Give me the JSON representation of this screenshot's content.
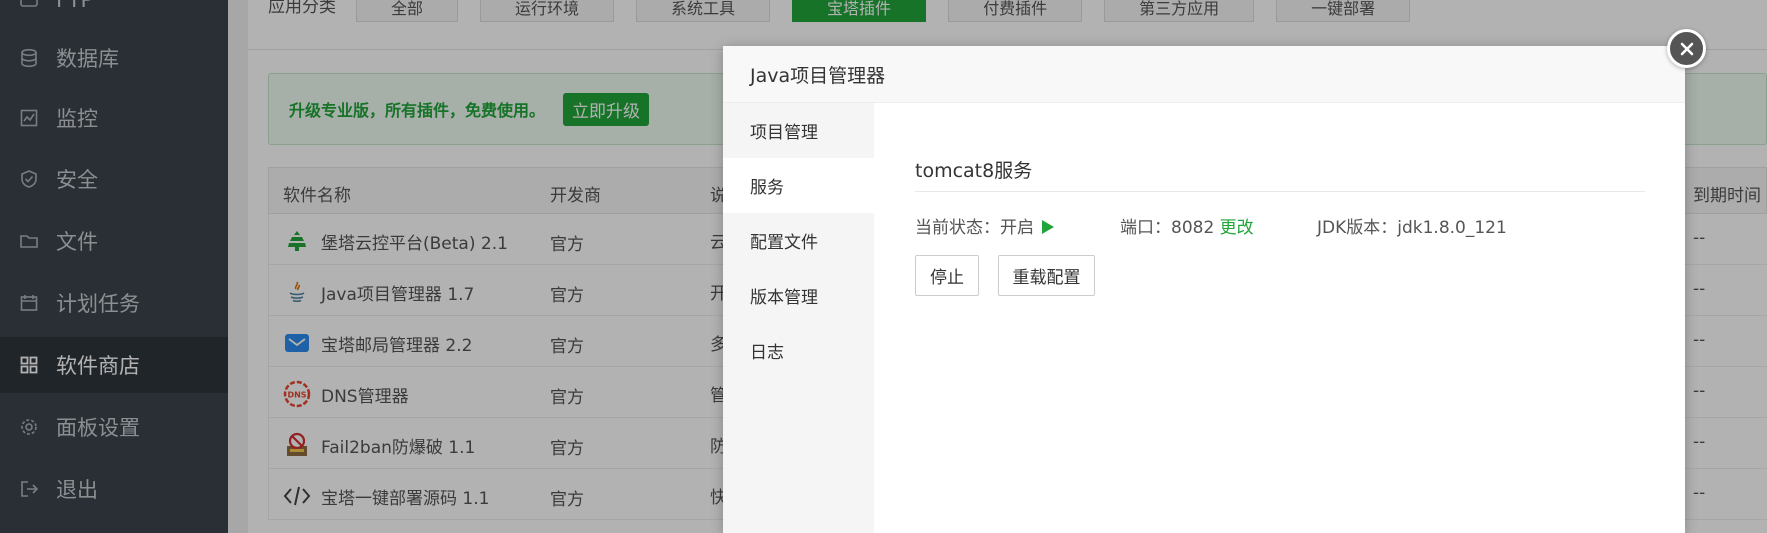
{
  "sidebar": {
    "items": [
      {
        "label": "FTP",
        "icon": "ftp-icon"
      },
      {
        "label": "数据库",
        "icon": "database-icon"
      },
      {
        "label": "监控",
        "icon": "monitor-icon"
      },
      {
        "label": "安全",
        "icon": "shield-icon"
      },
      {
        "label": "文件",
        "icon": "folder-icon"
      },
      {
        "label": "计划任务",
        "icon": "calendar-icon"
      },
      {
        "label": "软件商店",
        "icon": "grid-icon"
      },
      {
        "label": "面板设置",
        "icon": "gear-icon"
      },
      {
        "label": "退出",
        "icon": "logout-icon"
      }
    ]
  },
  "categories": {
    "label": "应用分类",
    "buttons": [
      "全部",
      "运行环境",
      "系统工具",
      "宝塔插件",
      "付费插件",
      "第三方应用",
      "一键部署"
    ],
    "active": "宝塔插件"
  },
  "upgrade": {
    "text": "升级专业版，所有插件，免费使用。",
    "button": "立即升级"
  },
  "table": {
    "headers": {
      "name": "软件名称",
      "developer": "开发商",
      "desc": "说明",
      "expire": "到期时间"
    },
    "rows": [
      {
        "name": "堡塔云控平台(Beta) 2.1",
        "developer": "官方",
        "desc": "云",
        "expire": "--",
        "icon": "cloud-tower-icon"
      },
      {
        "name": "Java项目管理器 1.7",
        "developer": "官方",
        "desc": "开",
        "expire": "--",
        "icon": "java-icon"
      },
      {
        "name": "宝塔邮局管理器 2.2",
        "developer": "官方",
        "desc": "多",
        "expire": "--",
        "icon": "mail-icon"
      },
      {
        "name": "DNS管理器",
        "developer": "官方",
        "desc": "管",
        "expire": "--",
        "icon": "dns-icon"
      },
      {
        "name": "Fail2ban防爆破 1.1",
        "developer": "官方",
        "desc": "防",
        "expire": "--",
        "icon": "fail2ban-icon"
      },
      {
        "name": "宝塔一键部署源码 1.1",
        "developer": "官方",
        "desc": "快",
        "expire": "--",
        "icon": "code-icon"
      }
    ]
  },
  "modal": {
    "title": "Java项目管理器",
    "tabs": [
      "项目管理",
      "服务",
      "配置文件",
      "版本管理",
      "日志"
    ],
    "active_tab": "服务",
    "service_title": "tomcat8服务",
    "status_label": "当前状态：开启",
    "port_label": "端口：8082",
    "port_change": "更改",
    "jdk_label": "JDK版本：jdk1.8.0_121",
    "stop_button": "停止",
    "reload_button": "重载配置"
  },
  "colors": {
    "accent": "#20a53a",
    "sidebar": "#3c444d"
  }
}
